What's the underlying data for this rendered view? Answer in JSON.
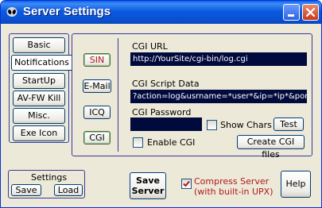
{
  "window": {
    "title": "Server Settings"
  },
  "nav": {
    "items": [
      "Basic",
      "Notifications",
      "StartUp",
      "AV-FW Kill",
      "Misc.",
      "Exe Icon"
    ]
  },
  "subtabs": [
    "SIN",
    "E-Mail",
    "ICQ",
    "CGI"
  ],
  "cgi": {
    "url_label": "CGI URL",
    "url_value": "http://YourSite/cgi-bin/log.cgi",
    "script_label": "CGI Script Data",
    "script_value": "?action=log&usrname=*user*&ip=*ip*&port=*p",
    "password_label": "CGI Password",
    "password_value": "",
    "show_chars_label": "Show Chars",
    "test_label": "Test",
    "enable_label": "Enable CGI",
    "create_files_label": "Create CGI files"
  },
  "settings": {
    "title": "Settings",
    "save_label": "Save",
    "load_label": "Load"
  },
  "save_server": {
    "line1": "Save",
    "line2": "Server"
  },
  "compress": {
    "line1": "Compress Server",
    "line2": "(with built-in UPX)",
    "checked": true,
    "color": "#b01818"
  },
  "help_label": "Help"
}
